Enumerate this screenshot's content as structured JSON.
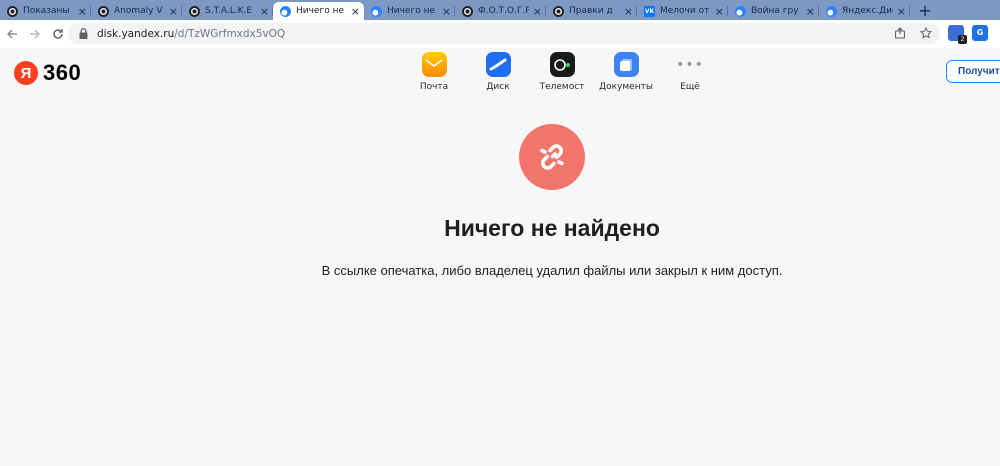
{
  "browser": {
    "tabs": [
      {
        "title": "Показаны",
        "favicon": "github-icon",
        "active": false
      },
      {
        "title": "Anomaly V",
        "favicon": "github-icon",
        "active": false
      },
      {
        "title": "S.T.A.L.K.E",
        "favicon": "github-icon",
        "active": false
      },
      {
        "title": "Ничего не",
        "favicon": "yandex-disk-icon",
        "active": true
      },
      {
        "title": "Ничего не",
        "favicon": "yandex-disk-icon",
        "active": false
      },
      {
        "title": "Ф.О.Т.О.Г.Р",
        "favicon": "github-icon",
        "active": false
      },
      {
        "title": "Правки д",
        "favicon": "github-icon",
        "active": false
      },
      {
        "title": "Мелочи от",
        "favicon": "vk-icon",
        "active": false
      },
      {
        "title": "Война гру",
        "favicon": "yandex-disk-icon",
        "active": false
      },
      {
        "title": "Яндекс.Дис",
        "favicon": "yandex-disk-icon",
        "active": false
      }
    ],
    "new_tab_label": "+",
    "close_glyph": "×",
    "url_host": "disk.yandex.ru",
    "url_path": "/d/TzWGrfmxdx5vOQ",
    "extension_badge": "2",
    "translate_label": "G"
  },
  "header": {
    "logo_letter": "Я",
    "logo_text": "360",
    "services": [
      {
        "label": "Почта",
        "icon": "mail-icon"
      },
      {
        "label": "Диск",
        "icon": "disk-icon"
      },
      {
        "label": "Телемост",
        "icon": "telemost-icon"
      },
      {
        "label": "Документы",
        "icon": "documents-icon"
      },
      {
        "label": "Ещё",
        "icon": "more-icon"
      }
    ],
    "login_label": "Получит"
  },
  "main": {
    "icon": "broken-link-icon",
    "title": "Ничего не найдено",
    "description": "В ссылке опечатка, либо владелец удалил файлы или закрыл к ним доступ."
  },
  "colors": {
    "tab_strip": "#7d98c4",
    "broken_link_circle": "#f1756a",
    "accent_blue": "#2c84ff",
    "yandex_red": "#fc3f1d"
  }
}
